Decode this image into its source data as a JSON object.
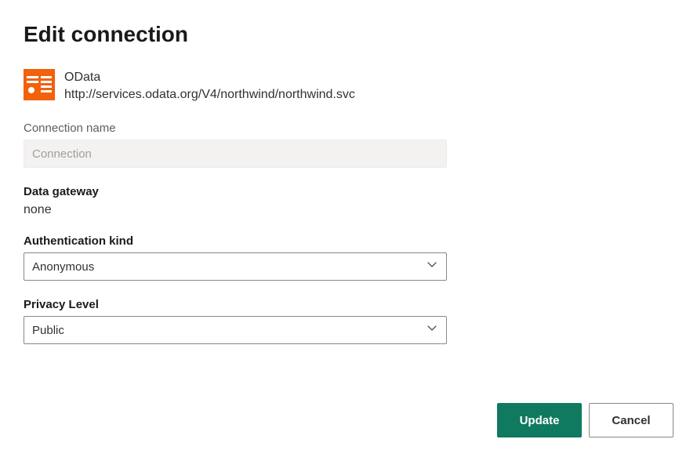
{
  "title": "Edit connection",
  "source": {
    "name": "OData",
    "url": "http://services.odata.org/V4/northwind/northwind.svc",
    "icon_fill": "#f2610c"
  },
  "fields": {
    "connection_name": {
      "label": "Connection name",
      "placeholder": "Connection",
      "value": ""
    },
    "data_gateway": {
      "label": "Data gateway",
      "value": "none"
    },
    "auth_kind": {
      "label": "Authentication kind",
      "selected": "Anonymous"
    },
    "privacy_level": {
      "label": "Privacy Level",
      "selected": "Public"
    }
  },
  "buttons": {
    "update": "Update",
    "cancel": "Cancel"
  }
}
